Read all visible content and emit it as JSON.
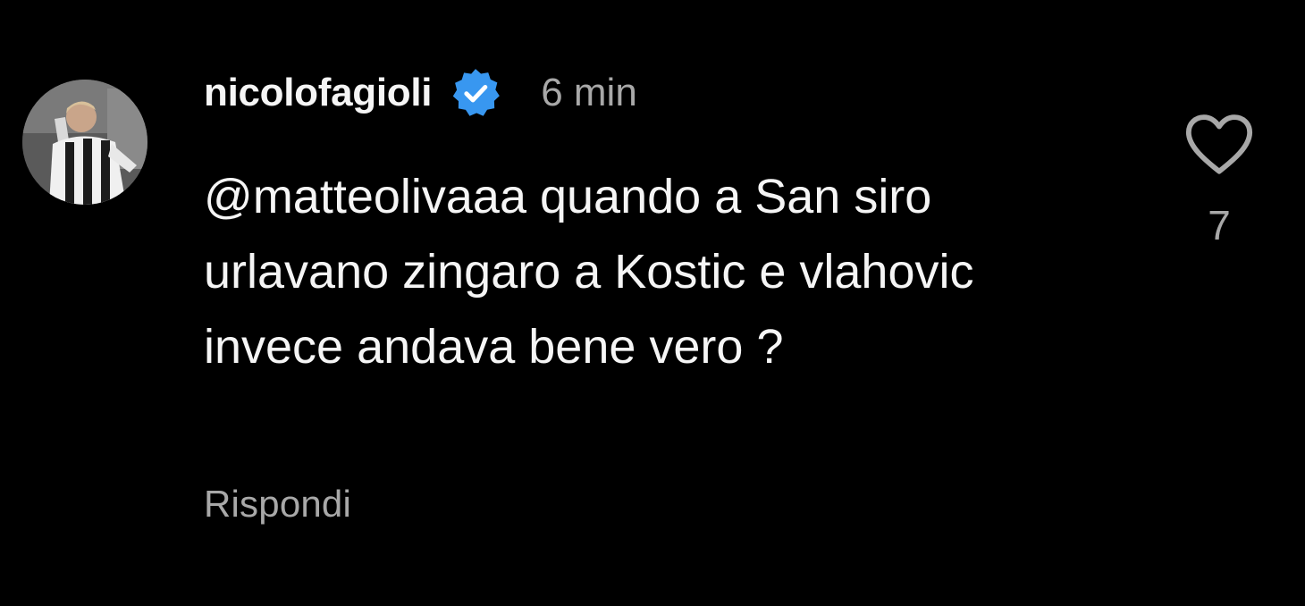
{
  "comment": {
    "username": "nicolofagioli",
    "verified": true,
    "verified_icon": "verified-badge-icon",
    "time": "6 min",
    "text": "@matteolivaaa quando a San siro urlavano zingaro a Kostic e vlahovic invece andava bene vero ?",
    "reply_label": "Rispondi",
    "likes": "7",
    "like_icon": "heart-outline-icon"
  },
  "colors": {
    "background": "#000000",
    "primary_text": "#f5f5f5",
    "secondary_text": "#a8a8a8",
    "verified_blue": "#3897f0"
  }
}
